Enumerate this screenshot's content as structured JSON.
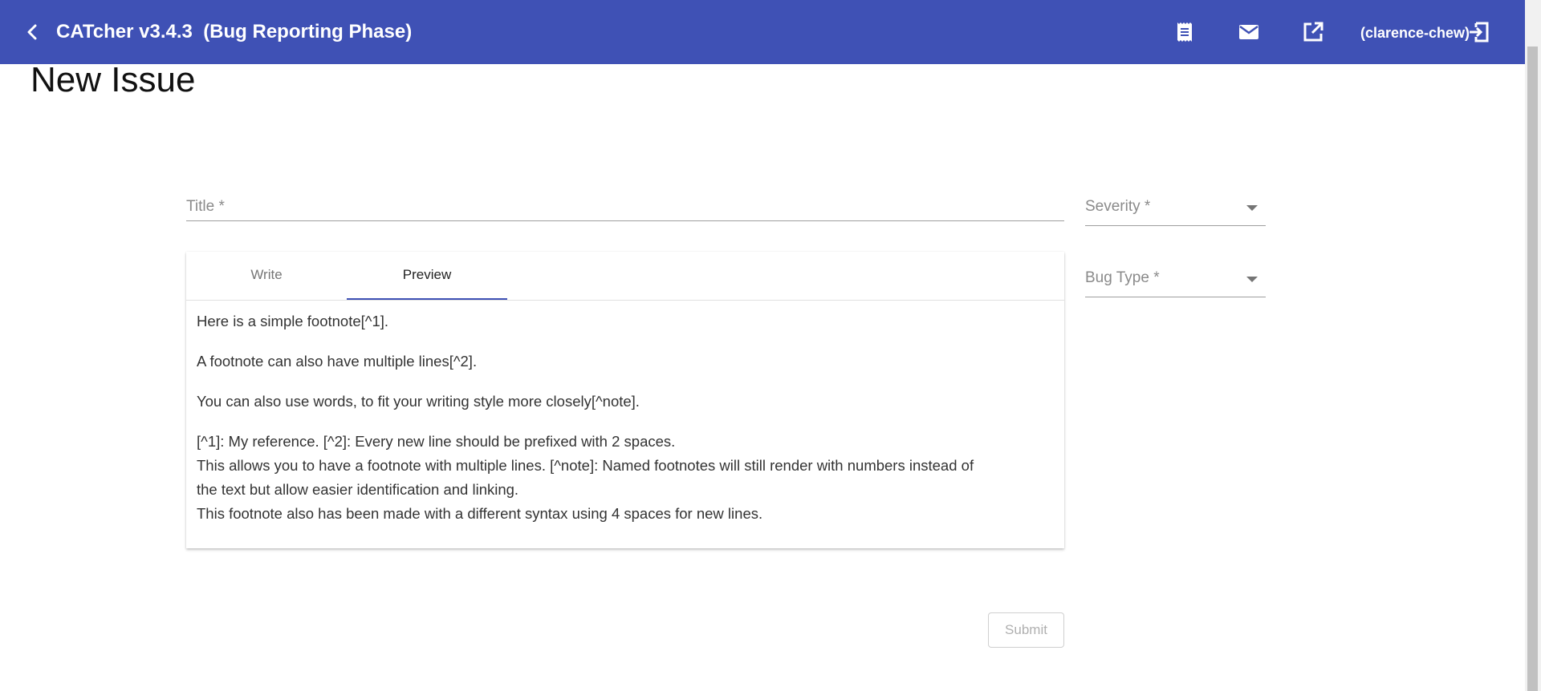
{
  "header": {
    "back_icon": "chevron-left-icon",
    "title": "CATcher v3.4.3  (Bug Reporting Phase)",
    "icons": [
      "receipt-icon",
      "mail-icon",
      "open-in-new-icon"
    ],
    "user": "(clarence-chew)",
    "logout_icon": "logout-icon",
    "color": "#3f51b5"
  },
  "page": {
    "title": "New Issue"
  },
  "form": {
    "title_label": "Title *",
    "severity_label": "Severity *",
    "bug_type_label": "Bug Type *",
    "tabs": [
      {
        "label": "Write",
        "active": false
      },
      {
        "label": "Preview",
        "active": true
      }
    ],
    "preview": {
      "p1": "Here is a simple footnote[^1].",
      "p2": "A footnote can also have multiple lines[^2].",
      "p3": "You can also use words, to fit your writing style more closely[^note].",
      "p4_line1": "[^1]: My reference. [^2]: Every new line should be prefixed with 2 spaces.",
      "p4_line2": "This allows you to have a footnote with multiple lines. [^note]: Named footnotes will still render with numbers instead of",
      "p4_line3": "the text but allow easier identification and linking.",
      "p4_line4": "This footnote also has been made with a different syntax using 4 spaces for new lines."
    },
    "submit_label": "Submit"
  }
}
